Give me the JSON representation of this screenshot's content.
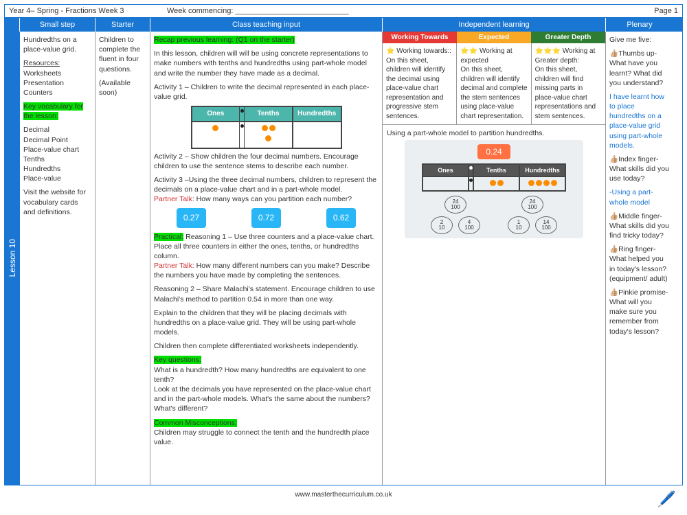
{
  "top": {
    "title": "Year 4– Spring - Fractions Week 3",
    "week_label": "Week commencing: ___________________________",
    "pageno": "Page 1"
  },
  "headers": {
    "small": "Small step",
    "starter": "Starter",
    "classinput": "Class teaching input",
    "indep": "Independent learning",
    "plenary": "Plenary"
  },
  "lesson_tab": "Lesson 10",
  "small_step": {
    "p1": "Hundredths on a place-value grid.",
    "res_h": "Resources:",
    "res": "Worksheets\nPresentation\nCounters",
    "kv_h": "Key vocabulary for the lesson:",
    "kv": "Decimal\nDecimal Point\nPlace-value chart\nTenths\nHundredths\nPlace-value",
    "p2": "Visit the website for vocabulary cards and definitions."
  },
  "starter": {
    "p1": "Children to complete the fluent in four questions.",
    "p2": "(Available soon)"
  },
  "classinput": {
    "recap": "Recap previous learning: (Q1 on the starter)",
    "intro": "In this lesson, children will will be using concrete representations to make numbers with tenths and hundredths using part-whole model and write the number they have made as a decimal.",
    "a1": "Activity 1 – Children to write the decimal represented in each place-value grid.",
    "pv_headers": {
      "ones": "Ones",
      "tenths": "Tenths",
      "hund": "Hundredths"
    },
    "a2": "Activity 2 – Show children the four decimal numbers. Encourage children to use the sentence stems to describe each number.",
    "a3": "Activity 3 –Using the three decimal numbers, children to represent the decimals on a place-value chart and in a part-whole model.",
    "pt1": "Partner Talk:",
    "pt1q": " How many ways can you partition each number?",
    "chips": [
      "0.27",
      "0.72",
      "0.62"
    ],
    "practical": "Practical:",
    "r1": " Reasoning 1 – Use three counters and a place-value chart. Place all three counters in either the ones, tenths, or hundredths column.",
    "pt2": "Partner Talk:",
    "pt2q": " How many different numbers can you make? Describe the numbers you have made by completing the sentences.",
    "r2": "Reasoning 2 – Share Malachi's statement. Encourage children to use Malachi's method to partition 0.54 in more than one way.",
    "explain": "Explain to the children that they will be placing decimals with hundredths on a place-value grid. They will be using part-whole models.",
    "diff": "Children then complete differentiated worksheets independently.",
    "kq_h": "Key questions:",
    "kq1": "What is a hundredth? How many hundredths are equivalent to one tenth?",
    "kq2": " Look at the decimals you have represented on the place-value chart and in the part-whole models. What's the same about the numbers? What's different?",
    "cm_h": "Common Misconceptions:",
    "cm": "Children may struggle to connect the tenth and the hundredth place value."
  },
  "indep_heads": {
    "wt": "Working Towards",
    "ex": "Expected",
    "gd": "Greater Depth"
  },
  "indep": {
    "wt_t": "⭐  Working towards::",
    "wt": "On this sheet, children will identify the decimal using place-value chart representation and progressive stem sentences.",
    "ex_t": "⭐⭐ Working at expected",
    "ex": "On this sheet, children will identify decimal and complete the stem sentences using place-value chart representation.",
    "gd_t": "⭐⭐⭐ Working at Greater depth:",
    "gd": "On this sheet, children will find missing parts in place-value chart representations and stem sentences."
  },
  "indep_img": {
    "caption": "Using a part-whole model to partition hundredths.",
    "top": "0.24",
    "ov1": "24\n100",
    "ov1a": "2\n10",
    "ov1b": "4\n100",
    "ov2": "24\n100",
    "ov2a": "1\n10",
    "ov2b": "14\n100"
  },
  "plenary": {
    "p1": "Give me five:",
    "thumb": "👍🏼Thumbs up- What have you learnt? What did you understand?",
    "learnt": "I have learnt how to place hundredths on a place-value grid using part-whole models.",
    "index": "👍🏼Index finger- What skills did you use today?",
    "using": "-Using a part-whole model",
    "middle": "👍🏼Middle finger- What skills did you find tricky today?",
    "ring": "👍🏼Ring finger- What helped you in today's lesson? (equipment/ adult)",
    "pinkie": "👍🏼Pinkie promise- What will you make sure you remember from today's lesson?"
  },
  "footer_url": "www.masterthecurriculum.co.uk"
}
